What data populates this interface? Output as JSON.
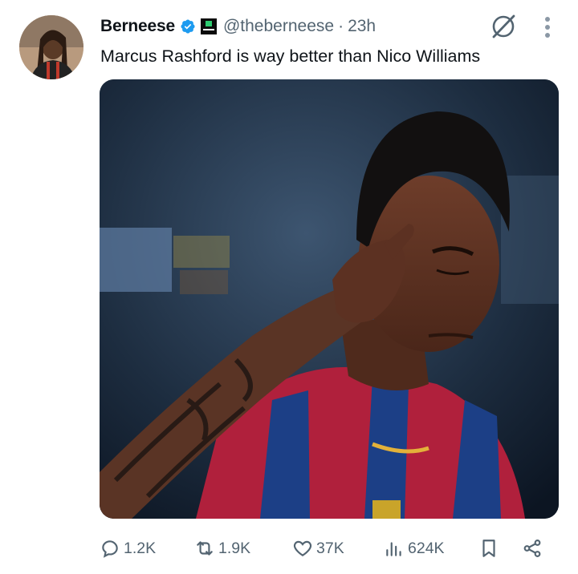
{
  "tweet": {
    "author": {
      "display_name": "Berneese",
      "handle": "@theberneese",
      "verified": true,
      "affiliation_badge": "BC GAME",
      "avatar_icon": "user-avatar-photo"
    },
    "separator": "·",
    "time": "23h",
    "text": "Marcus Rashford is way better than Nico Williams",
    "media": {
      "type": "image",
      "subject": "football player in red and blue striped jersey"
    },
    "stats": {
      "replies": "1.2K",
      "reposts": "1.9K",
      "likes": "37K",
      "views": "624K"
    }
  },
  "colors": {
    "text_primary": "#0f1419",
    "text_secondary": "#536471",
    "verified_blue": "#1d9bf0",
    "background": "#ffffff"
  },
  "icons": [
    "grok-icon",
    "more-vertical-icon",
    "reply-icon",
    "repost-icon",
    "like-icon",
    "views-icon",
    "bookmark-icon",
    "share-icon"
  ]
}
